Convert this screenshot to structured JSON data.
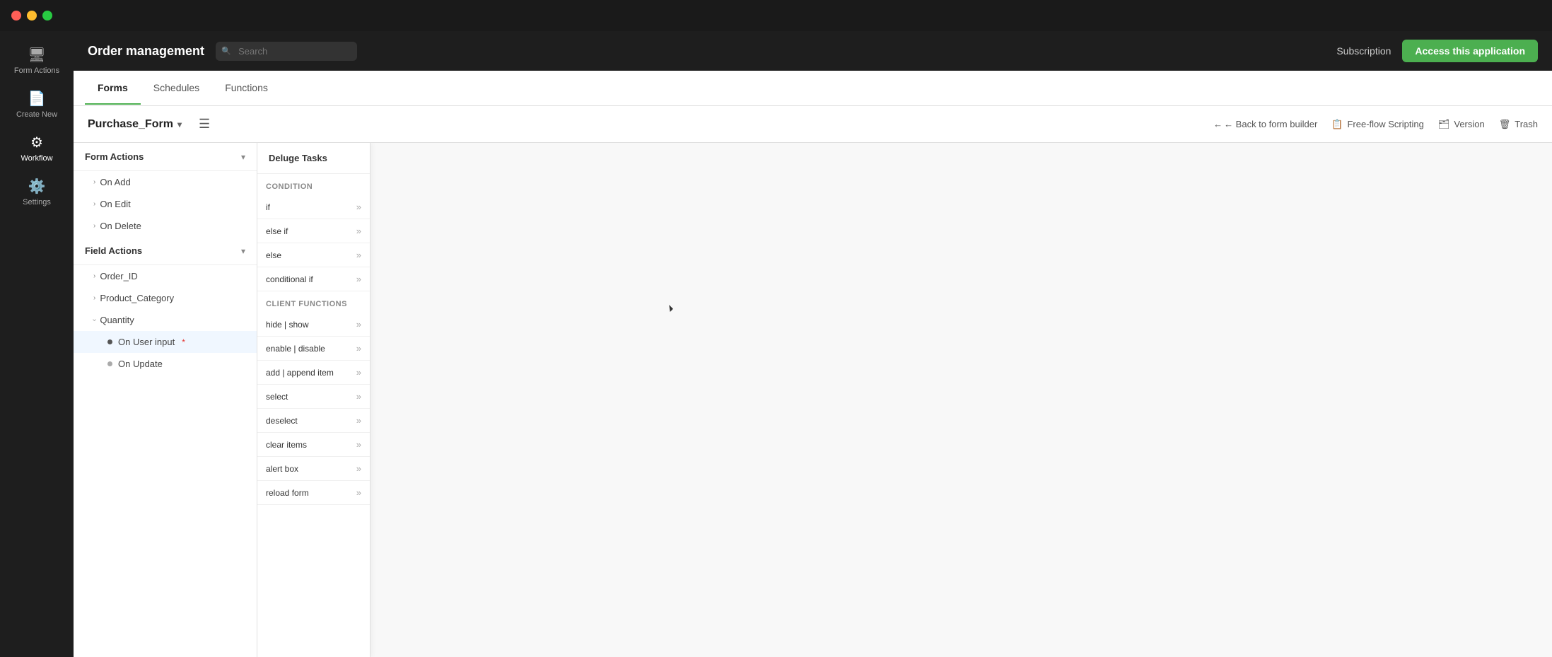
{
  "titlebar": {
    "lights": [
      "red",
      "yellow",
      "green"
    ]
  },
  "topbar": {
    "app_title": "Order management",
    "search_placeholder": "Search",
    "subscription_label": "Subscription",
    "access_btn_label": "Access this application"
  },
  "form_tabs": {
    "tabs": [
      {
        "label": "Forms",
        "active": true
      },
      {
        "label": "Schedules",
        "active": false
      },
      {
        "label": "Functions",
        "active": false
      }
    ]
  },
  "form_header": {
    "form_name": "Purchase_Form",
    "back_label": "← Back to form builder",
    "freeflow_label": "Free-flow Scripting",
    "version_label": "Version",
    "trash_label": "Trash"
  },
  "left_panel": {
    "sections": [
      {
        "label": "Form Actions",
        "expanded": true,
        "items": [
          {
            "label": "On Add",
            "type": "chevron"
          },
          {
            "label": "On Edit",
            "type": "chevron"
          },
          {
            "label": "On Delete",
            "type": "chevron"
          }
        ]
      },
      {
        "label": "Field Actions",
        "expanded": true,
        "items": [
          {
            "label": "Order_ID",
            "type": "chevron"
          },
          {
            "label": "Product_Category",
            "type": "chevron"
          },
          {
            "label": "Quantity",
            "type": "chevron-open",
            "children": [
              {
                "label": "On User input",
                "active": true,
                "required": true
              },
              {
                "label": "On Update",
                "active": false
              }
            ]
          }
        ]
      }
    ]
  },
  "tasks_panel": {
    "header": "Deluge Tasks",
    "condition_label": "Condition",
    "conditions": [
      {
        "label": "if"
      },
      {
        "label": "else if"
      },
      {
        "label": "else"
      },
      {
        "label": "conditional if"
      }
    ],
    "client_functions_label": "Client functions",
    "client_functions": [
      {
        "label": "hide | show"
      },
      {
        "label": "enable | disable"
      },
      {
        "label": "add | append item"
      },
      {
        "label": "select"
      },
      {
        "label": "deselect"
      },
      {
        "label": "clear items"
      },
      {
        "label": "alert box"
      },
      {
        "label": "reload form"
      }
    ]
  }
}
